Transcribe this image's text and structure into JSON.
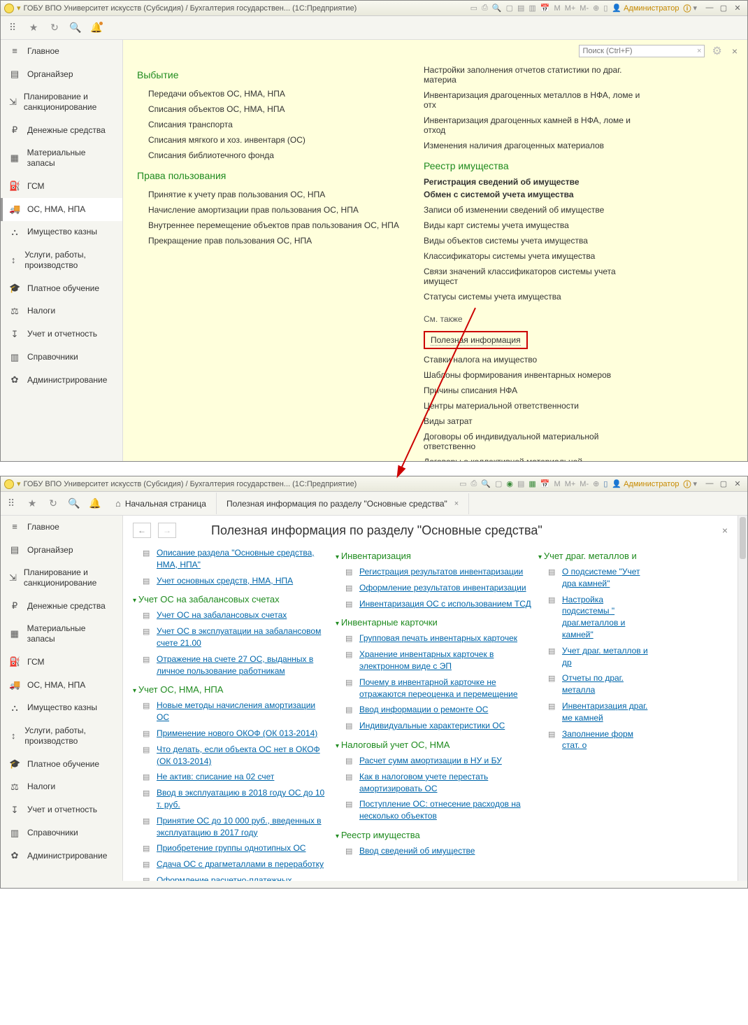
{
  "window1": {
    "title": "ГОБУ ВПО Университет искусств (Субсидия) / Бухгалтерия государствен...  (1С:Предприятие)",
    "admin": "Администратор",
    "search_placeholder": "Поиск (Ctrl+F)",
    "sidebar": [
      {
        "icon": "≡",
        "label": "Главное"
      },
      {
        "icon": "▤",
        "label": "Органайзер"
      },
      {
        "icon": "⇲",
        "label": "Планирование и санкционирование"
      },
      {
        "icon": "₽",
        "label": "Денежные средства"
      },
      {
        "icon": "▦",
        "label": "Материальные запасы"
      },
      {
        "icon": "⛽",
        "label": "ГСМ"
      },
      {
        "icon": "🚚",
        "label": "ОС, НМА, НПА"
      },
      {
        "icon": "⛬",
        "label": "Имущество казны"
      },
      {
        "icon": "↕",
        "label": "Услуги, работы, производство"
      },
      {
        "icon": "🎓",
        "label": "Платное обучение"
      },
      {
        "icon": "⚖",
        "label": "Налоги"
      },
      {
        "icon": "↧",
        "label": "Учет и отчетность"
      },
      {
        "icon": "▥",
        "label": "Справочники"
      },
      {
        "icon": "✿",
        "label": "Администрирование"
      }
    ],
    "sidebar_active": 6,
    "col1": {
      "groups": [
        {
          "title": "Выбытие",
          "items": [
            "Передачи объектов ОС, НМА, НПА",
            "Списания объектов ОС, НМА, НПА",
            "Списания транспорта",
            "Списания мягкого и хоз. инвентаря (ОС)",
            "Списания библиотечного фонда"
          ]
        },
        {
          "title": "Права пользования",
          "items": [
            "Принятие к учету прав пользования ОС, НПА",
            "Начисление амортизации прав пользования ОС, НПА",
            "Внутреннее перемещение объектов прав пользования ОС, НПА",
            "Прекращение прав пользования ОС, НПА"
          ]
        }
      ]
    },
    "col2": {
      "top_items": [
        "Настройки заполнения отчетов статистики по драг. материа",
        "Инвентаризация драгоценных металлов в НФА, ломе и отх",
        "Инвентаризация драгоценных камней в НФА, ломе и отход",
        "Изменения наличия драгоценных материалов"
      ],
      "group_title": "Реестр имущества",
      "bold": [
        "Регистрация сведений об имуществе",
        "Обмен с системой учета имущества"
      ],
      "items": [
        "Записи об изменении сведений об имуществе",
        "Виды карт системы учета имущества",
        "Виды объектов системы учета имущества",
        "Классификаторы системы учета имущества",
        "Связи значений классификаторов системы учета имущест",
        "Статусы системы учета имущества"
      ],
      "see_also": "См. также",
      "highlight": "Полезная информация",
      "rest": [
        "Ставки налога на имущество",
        "Шаблоны формирования инвентарных номеров",
        "Причины списания НФА",
        "Центры материальной ответственности",
        "Виды затрат",
        "Договоры об индивидуальной материальной ответственно",
        "Договоры о коллективной материальной ответственности"
      ]
    }
  },
  "window2": {
    "title": "ГОБУ ВПО Университет искусств (Субсидия) / Бухгалтерия государствен...  (1С:Предприятие)",
    "admin": "Администратор",
    "tab_home": "Начальная страница",
    "tab_active": "Полезная информация по разделу \"Основные средства\"",
    "page_title": "Полезная информация по разделу \"Основные средства\"",
    "col1": [
      {
        "type": "link",
        "text": "Описание раздела \"Основные средства, НМА, НПА\""
      },
      {
        "type": "link",
        "text": "Учет основных средств, НМА, НПА"
      },
      {
        "type": "grp",
        "text": "Учет ОС на забалансовых счетах"
      },
      {
        "type": "link",
        "text": "Учет ОС на забалансовых счетах"
      },
      {
        "type": "link",
        "text": "Учет ОС в эксплуатации на забалансовом счете 21.00"
      },
      {
        "type": "link",
        "text": "Отражение на счете 27 ОС, выданных в личное пользование работникам"
      },
      {
        "type": "grp",
        "text": "Учет ОС, НМА, НПА"
      },
      {
        "type": "link",
        "text": "Новые методы начисления амортизации ОС"
      },
      {
        "type": "link",
        "text": "Применение нового ОКОФ (ОК 013-2014)"
      },
      {
        "type": "link",
        "text": "Что делать, если объекта ОС нет в ОКОФ (ОК 013-2014)"
      },
      {
        "type": "link",
        "text": "Не актив: списание на 02 счет"
      },
      {
        "type": "link",
        "text": "Ввод в эксплуатацию в 2018 году ОС до 10 т. руб."
      },
      {
        "type": "link",
        "text": "Принятие ОС до 10 000 руб., введенных в эксплуатацию в 2017 году"
      },
      {
        "type": "link",
        "text": "Приобретение группы однотипных ОС"
      },
      {
        "type": "link",
        "text": "Сдача ОС с драгметаллами в переработку"
      },
      {
        "type": "link",
        "text": "Оформление расчетно-платежных"
      }
    ],
    "col2": [
      {
        "type": "grp",
        "text": "Инвентаризация"
      },
      {
        "type": "link",
        "text": "Регистрация результатов инвентаризации"
      },
      {
        "type": "link",
        "text": "Оформление результатов инвентаризации"
      },
      {
        "type": "link",
        "text": "Инвентаризация ОС с использованием ТСД"
      },
      {
        "type": "grp",
        "text": "Инвентарные карточки"
      },
      {
        "type": "link",
        "text": "Групповая печать инвентарных карточек"
      },
      {
        "type": "link",
        "text": "Хранение инвентарных карточек в электронном виде с ЭП"
      },
      {
        "type": "link",
        "text": "Почему в инвентарной карточке не отражаются переоценка и перемещение"
      },
      {
        "type": "link",
        "text": "Ввод информации о ремонте ОС"
      },
      {
        "type": "link",
        "text": "Индивидуальные характеристики ОС"
      },
      {
        "type": "grp",
        "text": "Налоговый учет ОС, НМА"
      },
      {
        "type": "link",
        "text": "Расчет сумм амортизации в НУ и БУ"
      },
      {
        "type": "link",
        "text": "Как в налоговом учете перестать амортизировать ОС"
      },
      {
        "type": "link",
        "text": "Поступление ОС: отнесение расходов на несколько объектов"
      },
      {
        "type": "grp",
        "text": "Реестр имущества"
      },
      {
        "type": "link",
        "text": "Ввод сведений об имуществе"
      }
    ],
    "col3": [
      {
        "type": "grp",
        "text": "Учет драг. металлов и"
      },
      {
        "type": "link",
        "text": "О подсистеме \"Учет дра камней\""
      },
      {
        "type": "link",
        "text": "Настройка подсистемы \" драг.металлов и камней\""
      },
      {
        "type": "link",
        "text": "Учет драг. металлов и др"
      },
      {
        "type": "link",
        "text": "Отчеты по драг. металла"
      },
      {
        "type": "link",
        "text": "Инвентаризация драг. ме камней"
      },
      {
        "type": "link",
        "text": "Заполнение форм стат. о"
      }
    ]
  }
}
